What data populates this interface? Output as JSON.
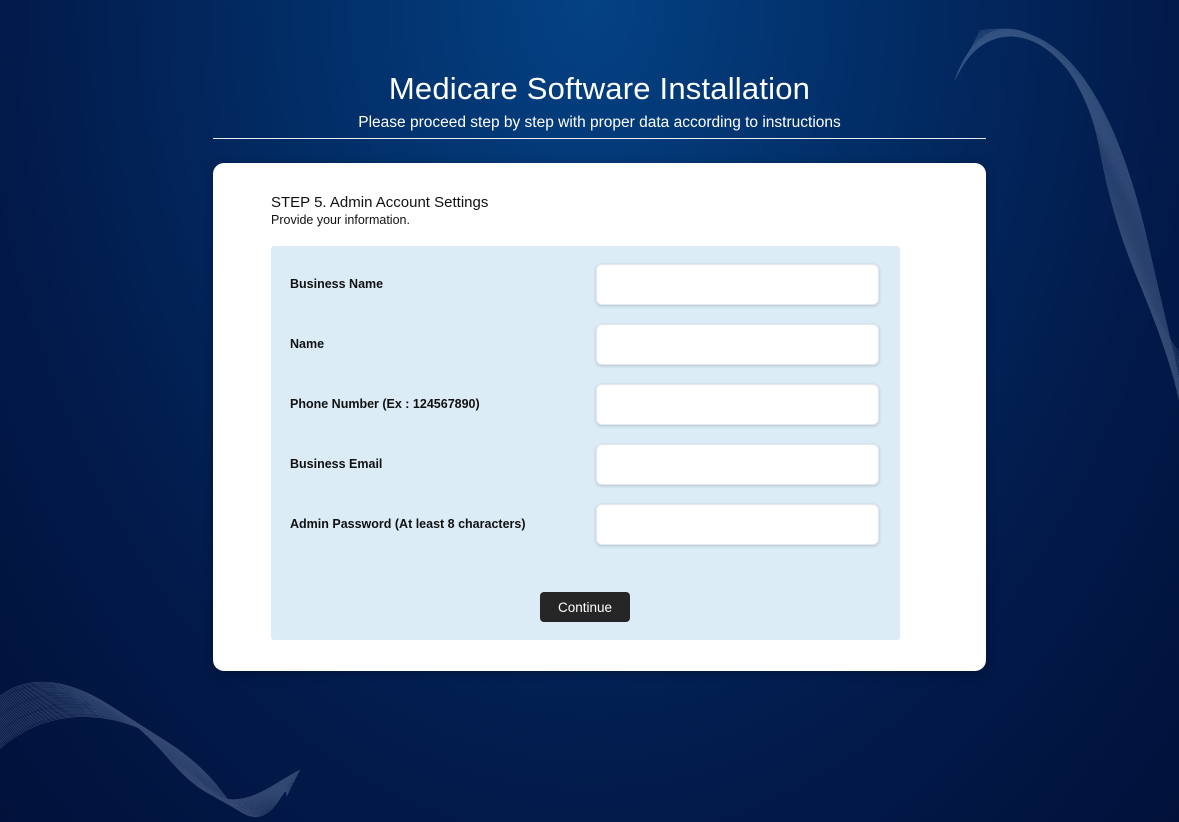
{
  "page": {
    "title": "Medicare Software Installation",
    "subtitle": "Please proceed step by step with proper data according to instructions"
  },
  "step": {
    "title": "STEP 5. Admin Account Settings",
    "subtitle": "Provide your information."
  },
  "form": {
    "fields": [
      {
        "label": "Business Name",
        "value": "",
        "placeholder": ""
      },
      {
        "label": "Name",
        "value": "",
        "placeholder": ""
      },
      {
        "label": "Phone Number (Ex : 124567890)",
        "value": "",
        "placeholder": ""
      },
      {
        "label": "Business Email",
        "value": "",
        "placeholder": ""
      },
      {
        "label": "Admin Password (At least 8 characters)",
        "value": "",
        "placeholder": ""
      }
    ],
    "continue_label": "Continue"
  },
  "colors": {
    "background": "#022d66",
    "panel": "#dbecf6",
    "button": "#262626"
  }
}
